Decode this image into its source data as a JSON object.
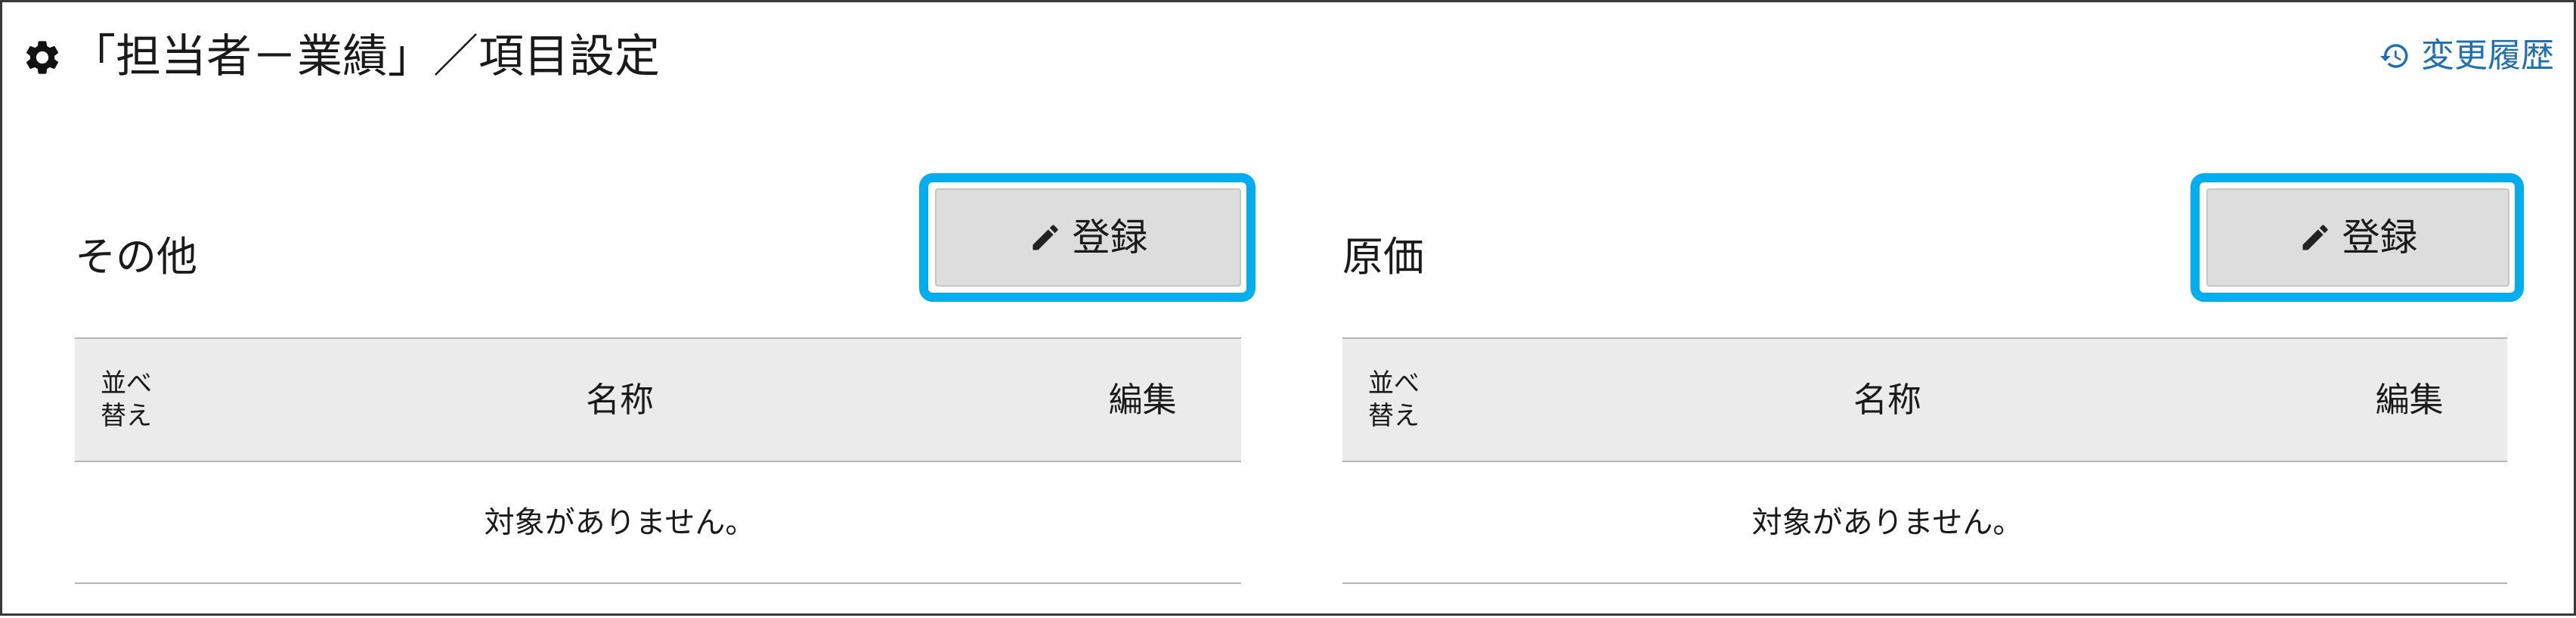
{
  "header": {
    "title": "「担当者－業績」／項目設定",
    "title_icon": "gear-icon",
    "history_label": "変更履歴",
    "history_icon": "history-icon"
  },
  "panels": [
    {
      "title": "その他",
      "register_label": "登録",
      "register_icon": "pencil-icon",
      "table": {
        "sort_header": [
          "並べ",
          "替え"
        ],
        "name_header": "名称",
        "edit_header": "編集",
        "empty_message": "対象がありません。"
      }
    },
    {
      "title": "原価",
      "register_label": "登録",
      "register_icon": "pencil-icon",
      "table": {
        "sort_header": [
          "並べ",
          "替え"
        ],
        "name_header": "名称",
        "edit_header": "編集",
        "empty_message": "対象がありません。"
      }
    }
  ],
  "colors": {
    "accent": "#00aeef",
    "link": "#1f6fb2",
    "button_bg": "#dddddd",
    "header_bg": "#ebebeb"
  }
}
